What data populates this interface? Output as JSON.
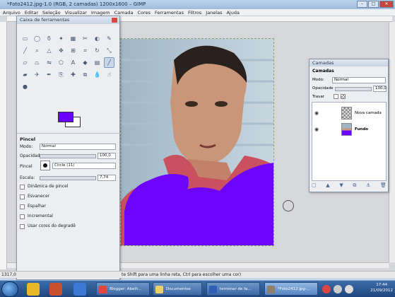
{
  "window": {
    "title": "*Foto2412.jpg-1.0 (RGB, 2 camadas) 1200x1600 – GIMP"
  },
  "menu": [
    "Arquivo",
    "Editar",
    "Seleção",
    "Visualizar",
    "Imagem",
    "Camada",
    "Cores",
    "Ferramentas",
    "Filtros",
    "Janelas",
    "Ajuda"
  ],
  "toolbox": {
    "title": "Caixa de ferramentas",
    "fg_color": "#6a00ff",
    "options": {
      "section": "Pincel",
      "mode_label": "Modo:",
      "mode_value": "Normal",
      "opacity_label": "Opacidade",
      "opacity_value": "100,0",
      "brush_label": "Pincel",
      "brush_value": "Circle (11)",
      "scale_label": "Escala:",
      "scale_value": "7,74",
      "dynamics": "Dinâmica de pincel",
      "checkboxes": [
        "Esvanecer",
        "Espalhar",
        "Incremental",
        "Usar cores do degradê"
      ]
    }
  },
  "layers": {
    "title": "Camadas",
    "subtitle": "Camadas",
    "mode_label": "Modo:",
    "mode_value": "Normal",
    "opacity_label": "Opacidade",
    "opacity_value": "100,0",
    "lock_label": "Travar",
    "items": [
      {
        "name": "Nova camada"
      },
      {
        "name": "Fundo"
      }
    ]
  },
  "status": {
    "coord": "1317,0",
    "hint": "te Shift para uma linha reta, Ctrl para escolher uma cor)"
  },
  "taskbar": {
    "tasks": [
      {
        "label": "Blogger: Abelh..."
      },
      {
        "label": "Documentos"
      },
      {
        "label": "terminar de fa..."
      },
      {
        "label": "*Foto2412.jpg-..."
      }
    ],
    "time": "17:44",
    "date": "21/09/2012"
  }
}
